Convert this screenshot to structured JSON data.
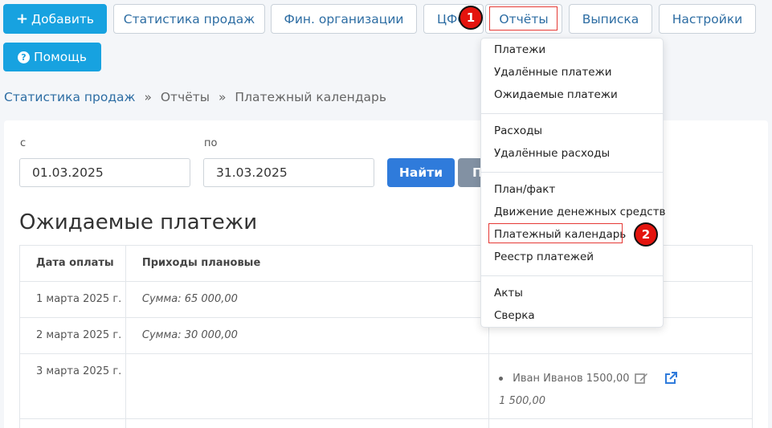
{
  "toolbar": {
    "add": "Добавить",
    "sales_stats": "Статистика продаж",
    "fin_orgs": "Фин. организации",
    "cfo": "ЦФО",
    "reports": "Отчёты",
    "statement": "Выписка",
    "settings": "Настройки",
    "help": "Помощь"
  },
  "markers": {
    "one": "1",
    "two": "2"
  },
  "breadcrumb": {
    "item1": "Статистика продаж",
    "sep": "»",
    "item2": "Отчёты",
    "item3": "Платежный календарь"
  },
  "filter": {
    "from_label": "с",
    "from_value": "01.03.2025",
    "to_label": "по",
    "to_value": "31.03.2025",
    "find": "Найти",
    "print_partial": "П"
  },
  "page_title": "Ожидаемые платежи",
  "table": {
    "headers": [
      "Дата оплаты",
      "Приходы плановые",
      ""
    ],
    "rows": [
      {
        "date": "1 марта 2025 г.",
        "income": "Сумма: 65 000,00",
        "payments": ""
      },
      {
        "date": "2 марта 2025 г.",
        "income": "Сумма: 30 000,00",
        "payments": ""
      },
      {
        "date": "3 марта 2025 г.",
        "income": "",
        "payment_item": "Иван Иванов 1500,00",
        "payment_sum": "1 500,00"
      }
    ]
  },
  "reports_menu": {
    "items": [
      "Платежи",
      "Удалённые платежи",
      "Ожидаемые платежи",
      "Расходы",
      "Удалённые расходы",
      "План/факт",
      "Движение денежных средств",
      "Платежный календарь",
      "Реестр платежей",
      "Акты",
      "Сверка"
    ],
    "selected": "Платежный календарь"
  },
  "colors": {
    "accent_cyan": "#17a2e0",
    "link_blue": "#2d6da3",
    "find_button": "#2f7bdb",
    "highlight_red": "#e53935"
  }
}
